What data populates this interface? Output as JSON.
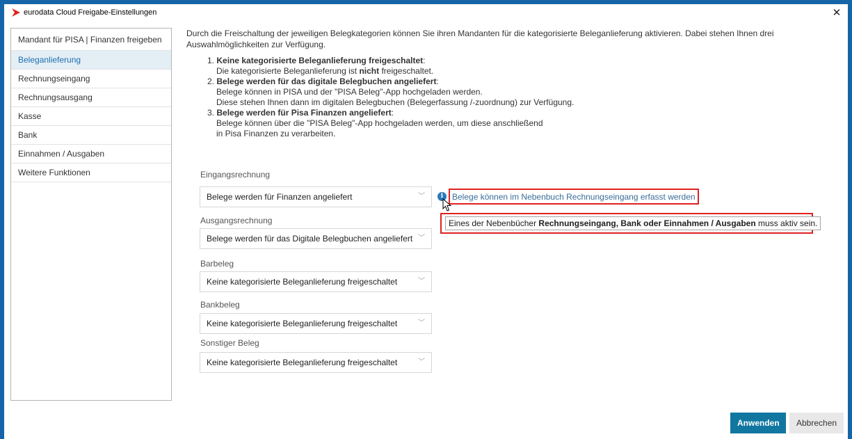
{
  "window": {
    "title": "eurodata Cloud Freigabe-Einstellungen",
    "close_symbol": "✕",
    "accent_color": "#1565a8",
    "logo_color": "#e2231a"
  },
  "sidebar": {
    "items": [
      {
        "label": "Mandant für PISA | Finanzen freigeben"
      },
      {
        "label": "Beleganlieferung"
      },
      {
        "label": "Rechnungseingang"
      },
      {
        "label": "Rechnungsausgang"
      },
      {
        "label": "Kasse"
      },
      {
        "label": "Bank"
      },
      {
        "label": "Einnahmen / Ausgaben"
      },
      {
        "label": "Weitere Funktionen"
      }
    ],
    "active_index": 1
  },
  "intro": {
    "text": "Durch die Freischaltung der jeweiligen Belegkategorien können Sie ihren Mandanten für die kategorisierte Beleganlieferung aktivieren. Dabei stehen Ihnen drei Auswahlmöglichkeiten zur Verfügung."
  },
  "options": [
    {
      "num": "1.",
      "title": "Keine kategorisierte Beleganlieferung freigeschaltet",
      "colon": ":",
      "line1_a": "Die kategorisierte Beleganlieferung ist ",
      "line1_b": "nicht",
      "line1_c": " freigeschaltet."
    },
    {
      "num": "2.",
      "title": "Belege werden für das digitale Belegbuchen angeliefert",
      "colon": ":",
      "line1": "Belege können in PISA und der \"PISA Beleg\"-App hochgeladen werden.",
      "line2": "Diese stehen Ihnen dann im digitalen Belegbuchen (Belegerfassung /-zuordnung) zur Verfügung."
    },
    {
      "num": "3.",
      "title": "Belege werden für Pisa Finanzen angeliefert",
      "colon": ":",
      "line1": "Belege können über die \"PISA Beleg\"-App hochgeladen werden, um diese anschließend",
      "line2": "in Pisa Finanzen zu verarbeiten."
    }
  ],
  "fields": [
    {
      "label": "Eingangsrechnung",
      "value": "Belege werden für Finanzen angeliefert"
    },
    {
      "label": "Ausgangsrechnung",
      "value": "Belege werden für das Digitale Belegbuchen angeliefert"
    },
    {
      "label": "Barbeleg",
      "value": "Keine kategorisierte Beleganlieferung freigeschaltet"
    },
    {
      "label": "Bankbeleg",
      "value": "Keine kategorisierte Beleganlieferung freigeschaltet"
    },
    {
      "label": "Sonstiger Beleg",
      "value": "Keine kategorisierte Beleganlieferung freigeschaltet"
    }
  ],
  "hint": {
    "info_symbol": "i",
    "text": "Belege können im Nebenbuch Rechnungseingang erfasst werden"
  },
  "tooltip": {
    "prefix": "Eines der Nebenbücher ",
    "bold": "Rechnungseingang, Bank oder Einnahmen / Ausgaben",
    "suffix": " muss aktiv sein."
  },
  "buttons": {
    "apply": "Anwenden",
    "cancel": "Abbrechen"
  },
  "icons": {
    "chevron": "chevron-down-icon",
    "info": "info-icon",
    "cursor": "mouse-cursor-icon"
  }
}
